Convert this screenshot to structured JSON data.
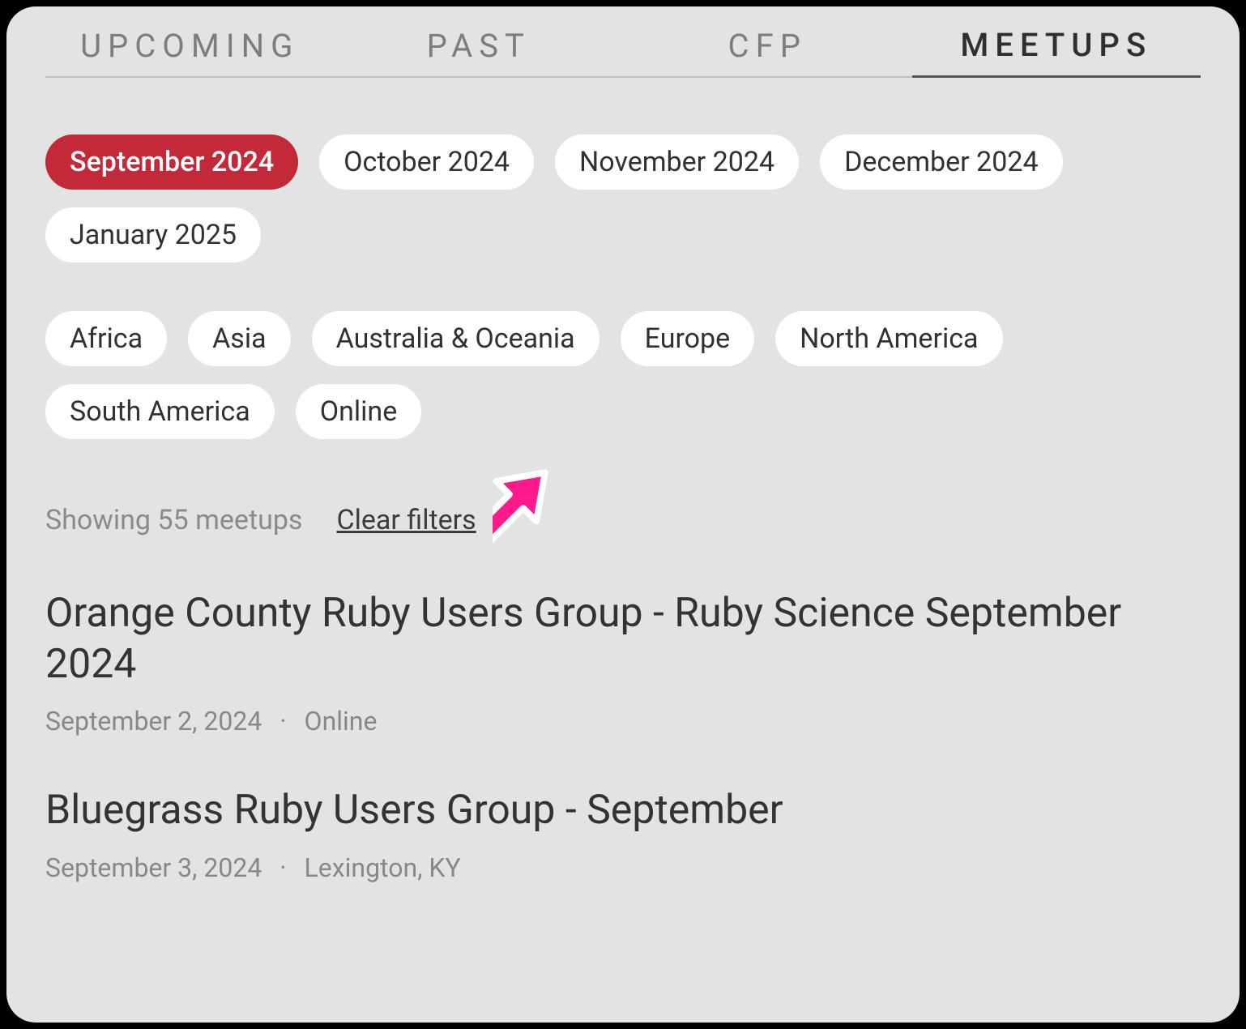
{
  "tabs": [
    {
      "label": "UPCOMING",
      "active": false
    },
    {
      "label": "PAST",
      "active": false
    },
    {
      "label": "CFP",
      "active": false
    },
    {
      "label": "MEETUPS",
      "active": true
    }
  ],
  "month_filters": [
    {
      "label": "September 2024",
      "selected": true
    },
    {
      "label": "October 2024",
      "selected": false
    },
    {
      "label": "November 2024",
      "selected": false
    },
    {
      "label": "December 2024",
      "selected": false
    },
    {
      "label": "January 2025",
      "selected": false
    }
  ],
  "region_filters": [
    {
      "label": "Africa"
    },
    {
      "label": "Asia"
    },
    {
      "label": "Australia & Oceania"
    },
    {
      "label": "Europe"
    },
    {
      "label": "North America"
    },
    {
      "label": "South America"
    },
    {
      "label": "Online"
    }
  ],
  "status": {
    "showing_label": "Showing 55 meetups",
    "clear_label": "Clear filters"
  },
  "meetups": [
    {
      "title": "Orange County Ruby Users Group - Ruby Science September 2024",
      "date": "September 2, 2024",
      "location": "Online"
    },
    {
      "title": "Bluegrass Ruby Users Group - September",
      "date": "September 3, 2024",
      "location": "Lexington, KY"
    }
  ],
  "separator": "·"
}
